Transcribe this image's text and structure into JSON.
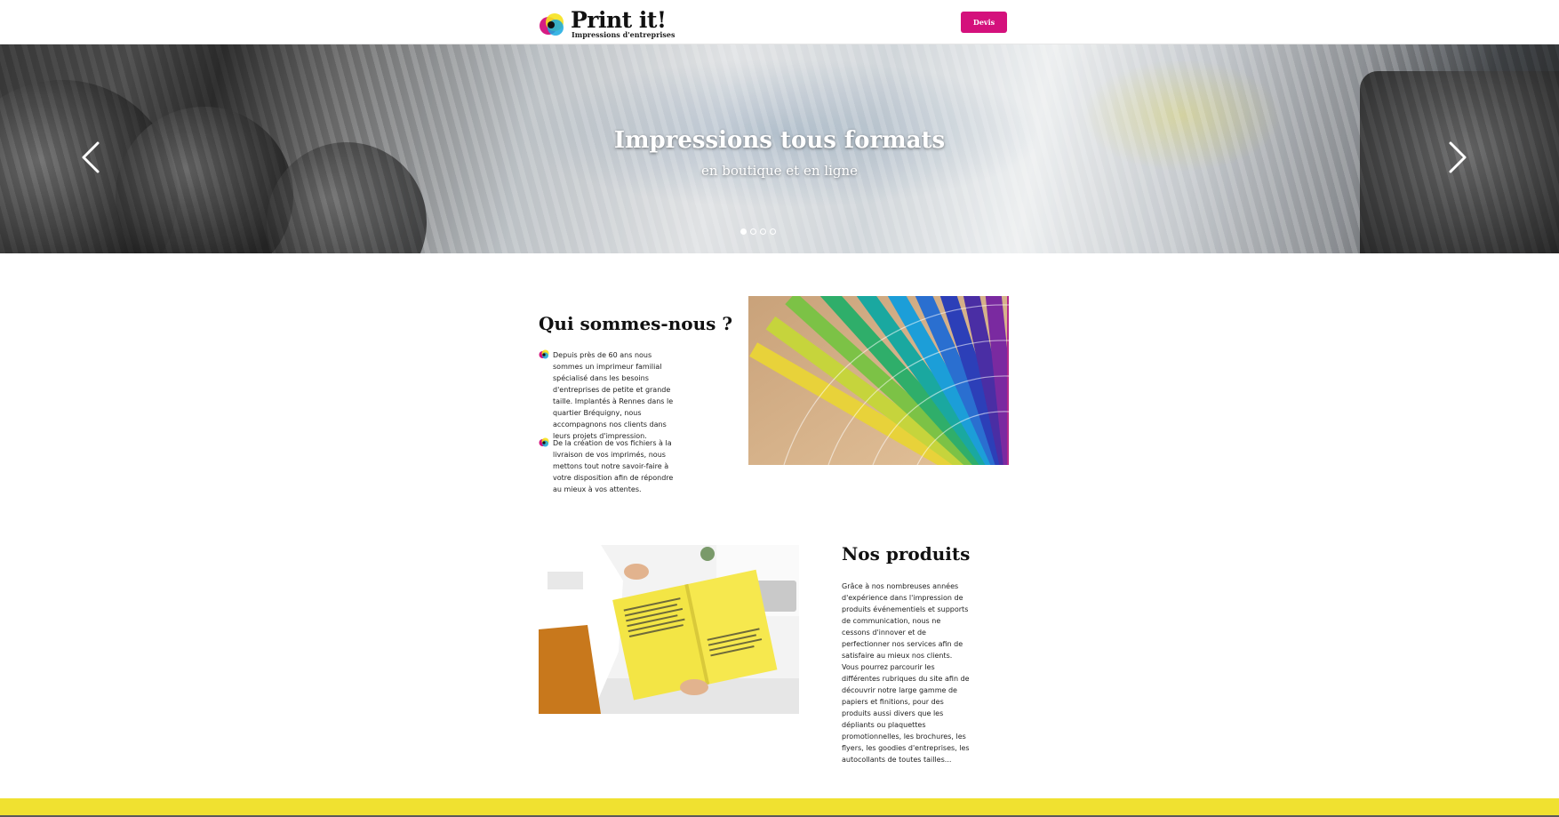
{
  "header": {
    "logo_title": "Print it!",
    "logo_subtitle": "Impressions d'entreprises",
    "devis_label": "Devis"
  },
  "hero": {
    "title": "Impressions tous formats",
    "subtitle": "en boutique et en ligne",
    "slide_count": 4,
    "active_slide": 1
  },
  "about": {
    "heading": "Qui sommes-nous ?",
    "paragraphs": [
      "Depuis près de 60 ans nous sommes un imprimeur familial spécialisé dans les besoins d'entreprises de petite et grande taille. Implantés à Rennes dans le quartier Bréquigny, nous accompagnons nos clients dans leurs projets d'impression.",
      "De la création de vos fichiers à la livraison de vos imprimés, nous mettons tout notre savoir-faire à votre disposition afin de répondre au mieux à vos attentes."
    ]
  },
  "products": {
    "heading": "Nos produits",
    "paragraph": "Grâce à nos nombreuses années d'expérience dans l'impression de produits événementiels et supports de communication, nous ne cessons d'innover et de perfectionner nos services afin de satisfaire au mieux nos clients. Vous pourrez parcourir les différentes rubriques du site afin de découvrir notre large gamme de papiers et finitions, pour des produits aussi divers que les dépliants ou plaquettes promotionnelles, les brochures, les flyers, les goodies d'entreprises, les autocollants de toutes tailles..."
  },
  "colors": {
    "accent_magenta": "#d4117c",
    "footer_yellow": "#f0e130",
    "logo_cyan": "#18a9e0",
    "logo_yellow": "#f6e21d"
  },
  "icons": {
    "prev": "chevron-left-icon",
    "next": "chevron-right-icon",
    "bullet": "cmyk-circles-icon"
  }
}
